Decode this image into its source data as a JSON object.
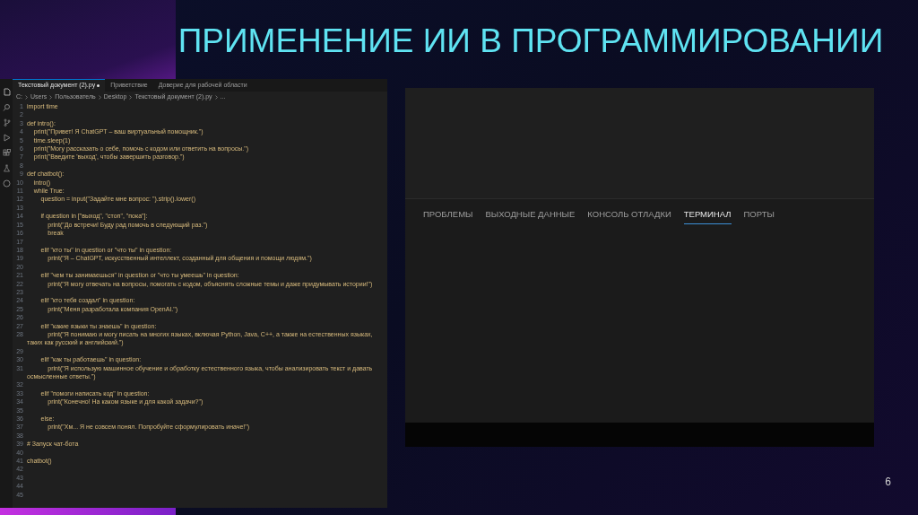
{
  "slide": {
    "title": "ПРИМЕНЕНИЕ ИИ В ПРОГРАММИРОВАНИИ",
    "page_number": "6"
  },
  "editor": {
    "tabs": [
      {
        "label": "Текстовый документ (2).py",
        "selected": true,
        "modified": true
      },
      {
        "label": "Приветствие",
        "selected": false,
        "modified": false
      },
      {
        "label": "Доверие для рабочей области",
        "selected": false,
        "modified": false
      }
    ],
    "breadcrumb": [
      "C:",
      "Users",
      "Пользователь",
      "Desktop",
      "Текстовый документ (2).py",
      "..."
    ],
    "lines": [
      {
        "number": "1",
        "text": "import time"
      },
      {
        "number": "2"
      },
      {
        "number": "3",
        "text": "def intro():"
      },
      {
        "number": "4",
        "text": "    print(\"Привет! Я ChatGPT – ваш виртуальный помощник.\")"
      },
      {
        "number": "5",
        "text": "    time.sleep(1)"
      },
      {
        "number": "6",
        "text": "    print(\"Могу рассказать о себе, помочь с кодом или ответить на вопросы.\")"
      },
      {
        "number": "7",
        "text": "    print(\"Введите 'выход', чтобы завершить разговор.\")"
      },
      {
        "number": "8"
      },
      {
        "number": "9",
        "text": "def chatbot():"
      },
      {
        "number": "10",
        "text": "    intro()"
      },
      {
        "number": "11",
        "text": "    while True:"
      },
      {
        "number": "12",
        "text": "        question = input(\"Задайте мне вопрос: \").strip().lower()"
      },
      {
        "number": "13"
      },
      {
        "number": "14",
        "text": "        if question in [\"выход\", \"стоп\", \"пока\"]:"
      },
      {
        "number": "15",
        "text": "            print(\"До встречи! Буду рад помочь в следующий раз.\")"
      },
      {
        "number": "16",
        "text": "            break"
      },
      {
        "number": "17"
      },
      {
        "number": "18",
        "text": "        elif \"кто ты\" in question or \"что ты\" in question:"
      },
      {
        "number": "19",
        "text": "            print(\"Я – ChatGPT, искусственный интеллект, созданный для общения и помощи людям.\")"
      },
      {
        "number": "20"
      },
      {
        "number": "21",
        "text": "        elif \"чем ты занимаешься\" in question or \"что ты умеешь\" in question:"
      },
      {
        "number": "22",
        "text": "            print(\"Я могу отвечать на вопросы, помогать с кодом, объяснять сложные темы и даже придумывать истории!\")"
      },
      {
        "number": "23"
      },
      {
        "number": "24",
        "text": "        elif \"кто тебя создал\" in question:"
      },
      {
        "number": "25",
        "text": "            print(\"Меня разработала компания OpenAI.\")"
      },
      {
        "number": "26"
      },
      {
        "number": "27",
        "text": "        elif \"какие языки ты знаешь\" in question:"
      },
      {
        "number": "28",
        "text": "            print(\"Я понимаю и могу писать на многих языках, включая Python, Java, C++, а также на естественных языках, таких как русский и английский.\")"
      },
      {
        "number": "29"
      },
      {
        "number": "30",
        "text": "        elif \"как ты работаешь\" in question:"
      },
      {
        "number": "31",
        "text": "            print(\"Я использую машинное обучение и обработку естественного языка, чтобы анализировать текст и давать осмысленные ответы.\")"
      },
      {
        "number": "32"
      },
      {
        "number": "33",
        "text": "        elif \"помоги написать код\" in question:"
      },
      {
        "number": "34",
        "text": "            print(\"Конечно! На каком языке и для какой задачи?\")"
      },
      {
        "number": "35"
      },
      {
        "number": "36",
        "text": "        else:"
      },
      {
        "number": "37",
        "text": "            print(\"Хм... Я не совсем понял. Попробуйте сформулировать иначе!\")"
      },
      {
        "number": "38"
      },
      {
        "number": "39",
        "text": "# Запуск чат-бота"
      },
      {
        "number": "40"
      },
      {
        "number": "41",
        "text": "chatbot()"
      },
      {
        "number": "42"
      },
      {
        "number": "43"
      },
      {
        "number": "44"
      },
      {
        "number": "45"
      }
    ]
  },
  "panel": {
    "tabs": [
      {
        "label": "ПРОБЛЕМЫ",
        "selected": false
      },
      {
        "label": "ВЫХОДНЫЕ ДАННЫЕ",
        "selected": false
      },
      {
        "label": "КОНСОЛЬ ОТЛАДКИ",
        "selected": false
      },
      {
        "label": "ТЕРМИНАЛ",
        "selected": true
      },
      {
        "label": "ПОРТЫ",
        "selected": false
      }
    ]
  }
}
